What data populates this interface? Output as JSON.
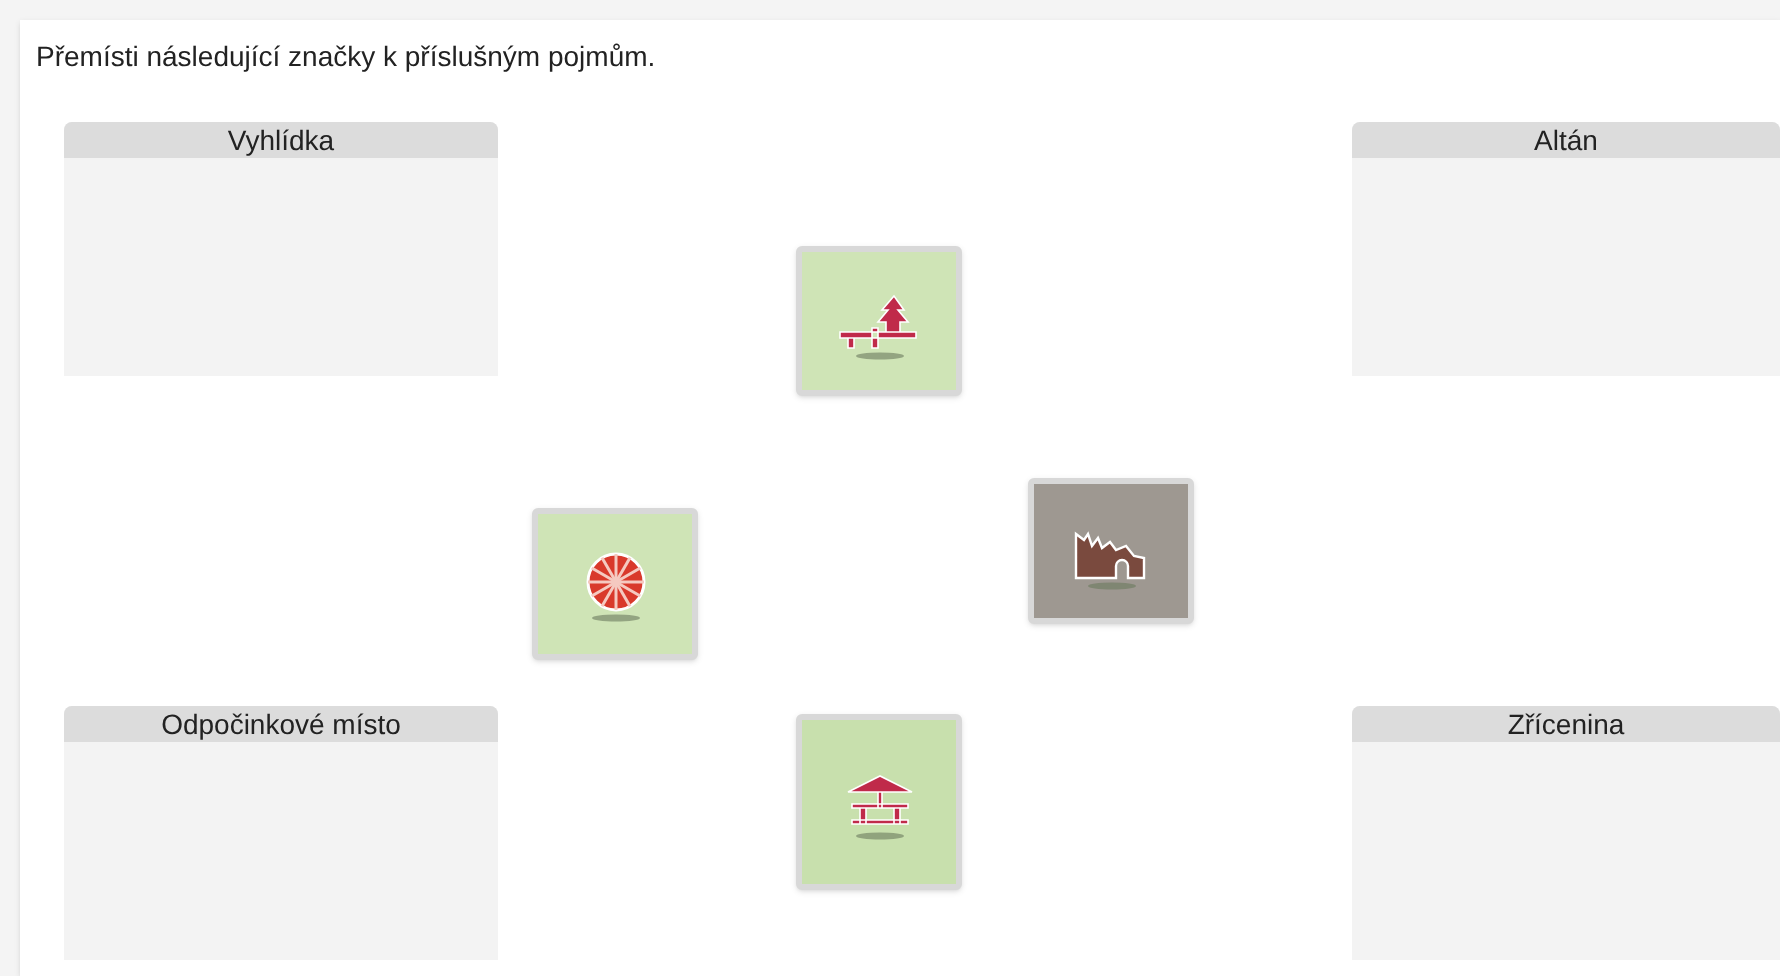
{
  "instruction": "Přemísti následující značky k příslušným pojmům.",
  "zones": [
    {
      "label": "Vyhlídka"
    },
    {
      "label": "Altán"
    },
    {
      "label": "Odpočinkové místo"
    },
    {
      "label": "Zřícenina"
    }
  ],
  "tiles": [
    {
      "kind": "bench"
    },
    {
      "kind": "viewpoint"
    },
    {
      "kind": "ruin"
    },
    {
      "kind": "shelter"
    }
  ]
}
